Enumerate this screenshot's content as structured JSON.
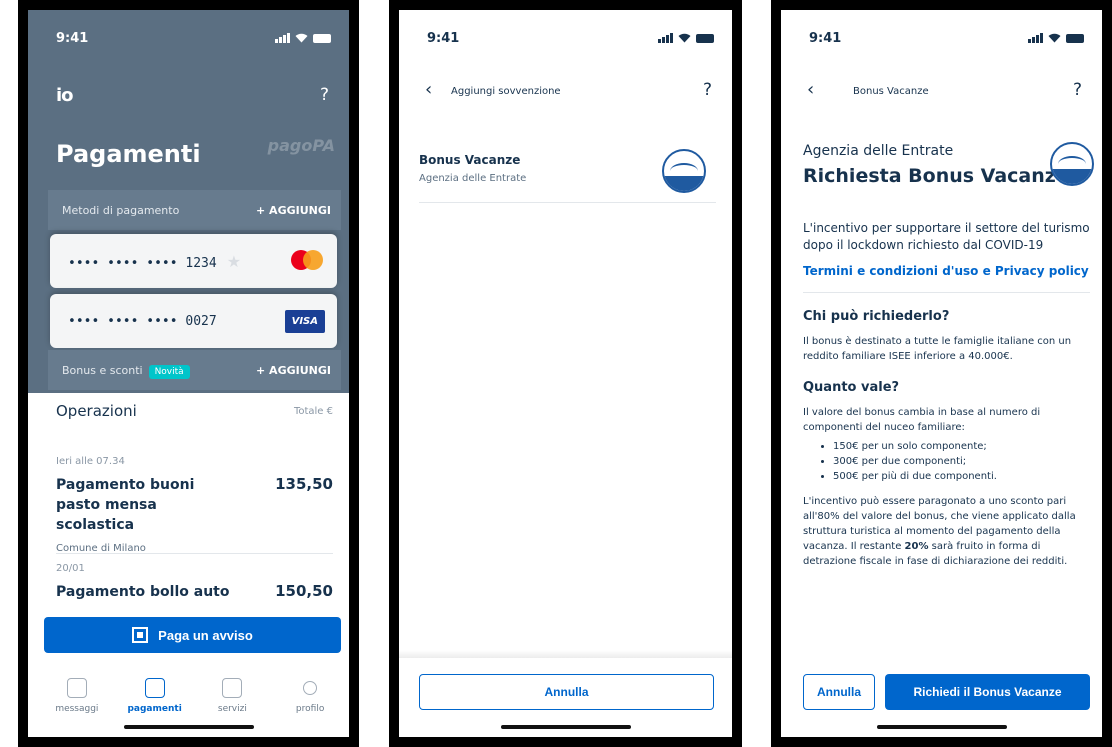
{
  "status_time": "9:41",
  "colors": {
    "primary": "#0066cc",
    "header_bg": "#5b6f82",
    "text": "#17324d",
    "badge": "#00c5ca"
  },
  "screen1": {
    "logo": "io",
    "help": "?",
    "title": "Pagamenti",
    "brand": "pagoPA",
    "methods": {
      "label": "Metodi di pagamento",
      "add": "+ AGGIUNGI"
    },
    "cards": [
      {
        "number": "•••• •••• •••• 1234",
        "brand_icon": "mastercard-icon"
      },
      {
        "number": "•••• •••• •••• 0027",
        "brand": "VISA"
      }
    ],
    "bonus": {
      "label": "Bonus e sconti",
      "badge": "Novità",
      "add": "+ AGGIUNGI"
    },
    "operations": {
      "title": "Operazioni",
      "total": "Totale €"
    },
    "transactions": [
      {
        "date": "Ieri alle 07.34",
        "desc": "Pagamento buoni pasto mensa scolastica",
        "amount": "135,50",
        "entity": "Comune di Milano"
      },
      {
        "date": "20/01",
        "desc": "Pagamento bollo auto",
        "amount": "150,50"
      }
    ],
    "pay_button": "Paga un avviso",
    "tabs": [
      {
        "label": "messaggi",
        "icon": "message-icon"
      },
      {
        "label": "pagamenti",
        "icon": "wallet-icon"
      },
      {
        "label": "servizi",
        "icon": "services-icon"
      },
      {
        "label": "profilo",
        "icon": "profile-icon"
      }
    ]
  },
  "screen2": {
    "nav_title": "Aggiungi sovvenzione",
    "help": "?",
    "item": {
      "title": "Bonus Vacanze",
      "subtitle": "Agenzia delle Entrate"
    },
    "cancel": "Annulla"
  },
  "screen3": {
    "nav_title": "Bonus Vacanze",
    "help": "?",
    "org": "Agenzia delle Entrate",
    "title": "Richiesta Bonus Vacanze",
    "intro": "L'incentivo per supportare il settore del turismo dopo il lockdown richiesto dal COVID-19",
    "terms_link": "Termini e condizioni d'uso e Privacy policy",
    "h_who": "Chi può richiederlo?",
    "who_text": "Il bonus è destinato a tutte le famiglie italiane con un reddito familiare ISEE inferiore a 40.000€.",
    "h_value": "Quanto vale?",
    "value_text": "Il valore del bonus cambia in base al numero di componenti del nuceo familiare:",
    "value_items": [
      "150€ per un solo componente;",
      "300€ per due componenti;",
      "500€ per più di due componenti."
    ],
    "detail_text_1": "L'incentivo può essere paragonato a uno sconto pari all'80% del valore del bonus, che viene applicato dalla struttura turistica al momento del pagamento della vacanza. Il restante ",
    "detail_bold": "20%",
    "detail_text_2": " sarà fruito in forma di detrazione fiscale in fase di dichiarazione dei redditi.",
    "cancel": "Annulla",
    "request": "Richiedi il Bonus Vacanze"
  }
}
